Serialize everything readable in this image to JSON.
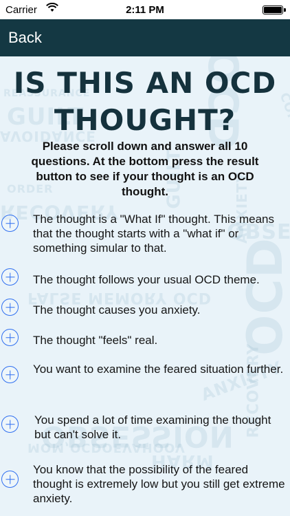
{
  "status_bar": {
    "carrier": "Carrier",
    "time": "2:11 PM",
    "wifi_icon": "wifi-icon",
    "battery_level": 1.0
  },
  "nav": {
    "back_label": "Back",
    "background_color": "#143843"
  },
  "header": {
    "title_line1": "IS THIS AN OCD",
    "title_line2": "THOUGHT?",
    "subtitle": "Please scroll down and answer all 10 questions. At the bottom press the result button to see if your thought is an OCD thought."
  },
  "questions": [
    {
      "text": "The thought is a \"What If\" thought. This means that the thought starts with a \"what if\" or something simular to that."
    },
    {
      "text": "The thought follows your usual OCD theme."
    },
    {
      "text": "The thought causes you anxiety."
    },
    {
      "text": "The thought \"feels\" real."
    },
    {
      "text": "You want to examine the feared situation further."
    },
    {
      "text": "You spend a lot of time examining the thought but can't solve it."
    },
    {
      "text": "You know that the possibility of the feared thought is extremely low but you still get extreme anxiety."
    }
  ],
  "background_words": [
    "OCD",
    "GUILT",
    "RECOVERY",
    "AVOIDANCE",
    "ANXIETY",
    "OBSESSION",
    "COMPULSIONS",
    "FALSE MEMORY OCD",
    "REASSURANCE",
    "HARM",
    "ORDER",
    "MOM,OCDOEVAHOOV"
  ],
  "colors": {
    "accent": "#2f6ff0",
    "title": "#15323d",
    "background": "#e9f3f9"
  }
}
